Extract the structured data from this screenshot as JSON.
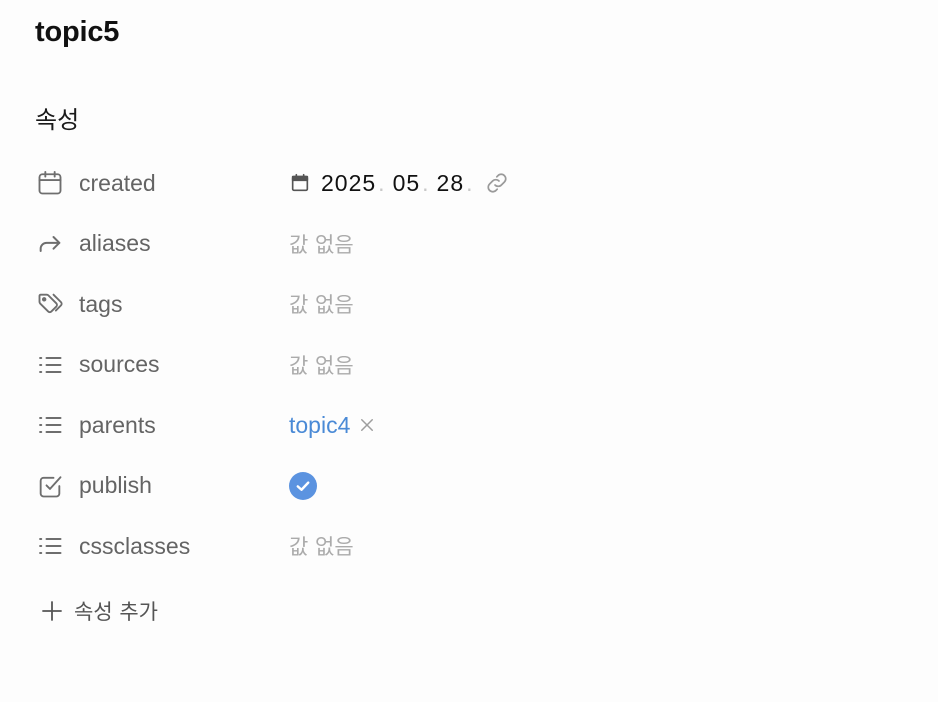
{
  "note_title": "topic5",
  "section_heading": "속성",
  "properties": [
    {
      "icon": "calendar-icon",
      "name": "created",
      "type": "date",
      "date": {
        "year": "2025",
        "month": "05",
        "day": "28",
        "sep": "."
      }
    },
    {
      "icon": "forward-arrow-icon",
      "name": "aliases",
      "type": "empty",
      "empty_text": "값 없음"
    },
    {
      "icon": "tags-icon",
      "name": "tags",
      "type": "empty",
      "empty_text": "값 없음"
    },
    {
      "icon": "list-icon",
      "name": "sources",
      "type": "empty",
      "empty_text": "값 없음"
    },
    {
      "icon": "list-icon",
      "name": "parents",
      "type": "link",
      "link_text": "topic4"
    },
    {
      "icon": "checkbox-icon",
      "name": "publish",
      "type": "checkbox",
      "checked": true
    },
    {
      "icon": "list-icon",
      "name": "cssclasses",
      "type": "empty",
      "empty_text": "값 없음"
    }
  ],
  "add_property_label": "속성 추가",
  "colors": {
    "link": "#4a8ad6",
    "check": "#5b93e0",
    "muted": "#ababab"
  }
}
